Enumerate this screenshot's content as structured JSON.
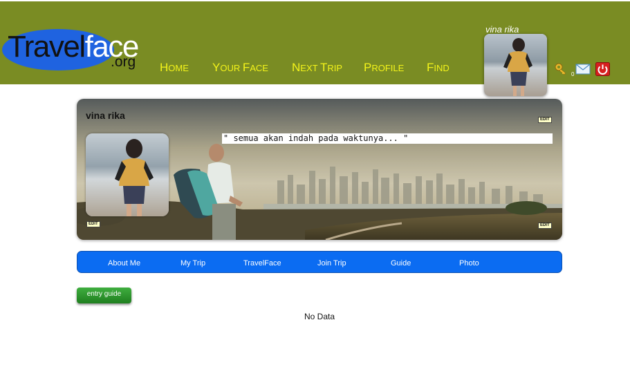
{
  "logo": {
    "part1": "Travel",
    "part2": "face",
    "suffix": ".org"
  },
  "nav": [
    {
      "first": "H",
      "rest": "ome"
    },
    {
      "first": "Y",
      "rest": "our "
    },
    {
      "first": "N",
      "rest": "ext "
    },
    {
      "first": "P",
      "rest": "rofile"
    },
    {
      "first": "F",
      "rest": "ind"
    }
  ],
  "nav_extra": {
    "face_first": "F",
    "face_rest": "ace",
    "trip_first": "T",
    "trip_rest": "rip"
  },
  "user": {
    "name": "vina rika",
    "key_count": "0"
  },
  "banner": {
    "name": "vina rika",
    "quote": "\" semua akan indah pada waktunya... \"",
    "edit_label": "EDIT"
  },
  "tabs": [
    "About Me",
    "My Trip",
    "TravelFace",
    "Join Trip",
    "Guide",
    "Photo"
  ],
  "entry_button": "entry guide",
  "empty_message": "No Data",
  "colors": {
    "header": "#7a8c23",
    "nav_text": "#f4f41a",
    "tabbar": "#0b6cf2",
    "entry_button": "#2d9a2d"
  }
}
